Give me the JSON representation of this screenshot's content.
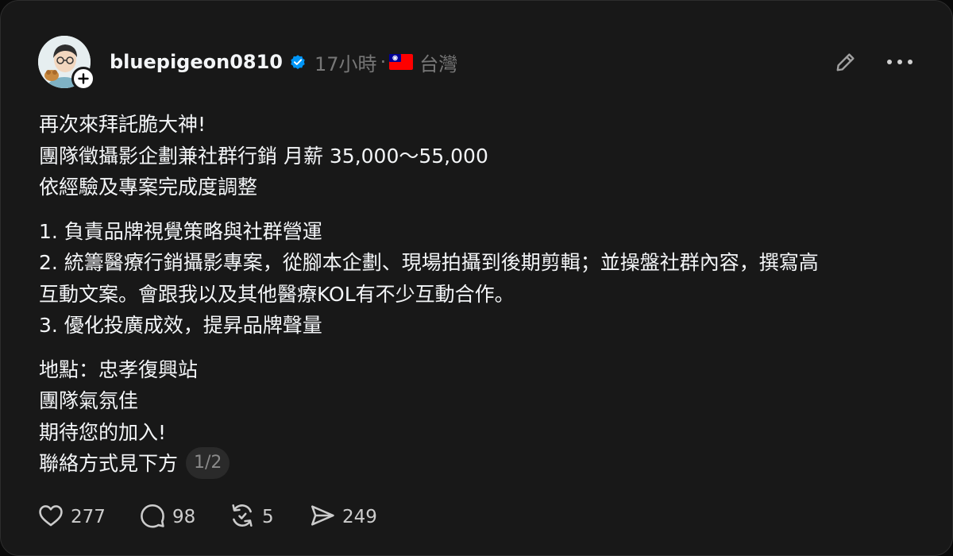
{
  "post": {
    "username": "bluepigeon0810",
    "time": "17小時",
    "separator": "·",
    "location": "台灣",
    "lines": [
      "再次來拜託脆大神!",
      "團隊徵攝影企劃兼社群行銷 月薪 35,000～55,000",
      "依經驗及專案完成度調整",
      "1. 負責品牌視覺策略與社群營運",
      "2. 統籌醫療行銷攝影專案，從腳本企劃、現場拍攝到後期剪輯；並操盤社群內容，撰寫高",
      "互動文案。會跟我以及其他醫療KOL有不少互動合作。",
      "3. 優化投廣成效，提昇品牌聲量",
      "地點：忠孝復興站",
      "團隊氣氛佳",
      "期待您的加入!",
      "聯絡方式見下方"
    ],
    "page_indicator": "1/2"
  },
  "actions": {
    "likes": "277",
    "replies": "98",
    "reposts": "5",
    "shares": "249"
  },
  "icons": {
    "verified": "verified-badge-icon",
    "flag": "taiwan-flag-icon",
    "edit": "pencil-icon",
    "more": "more-icon",
    "like": "heart-icon",
    "reply": "comment-icon",
    "repost": "repost-icon",
    "share": "send-icon",
    "follow": "plus-icon"
  },
  "colors": {
    "background": "#181818",
    "text": "#f3f5f7",
    "muted": "#777777",
    "verified": "#0095f6"
  }
}
